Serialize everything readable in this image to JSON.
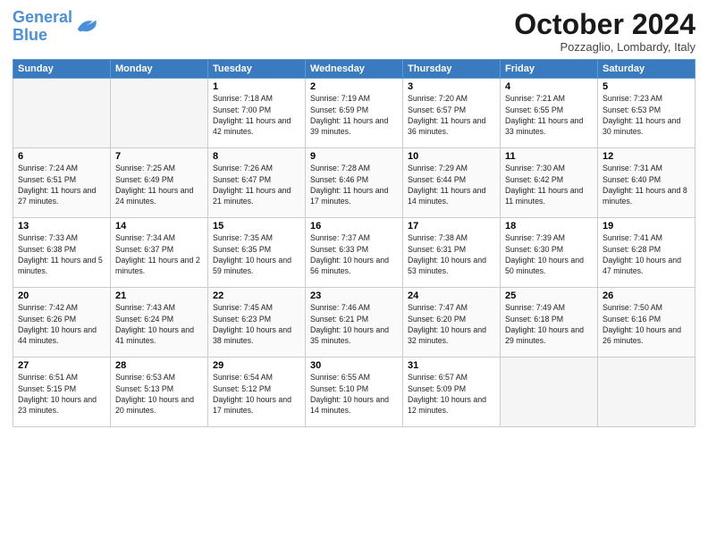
{
  "header": {
    "logo_line1": "General",
    "logo_line2": "Blue",
    "month": "October 2024",
    "location": "Pozzaglio, Lombardy, Italy"
  },
  "weekdays": [
    "Sunday",
    "Monday",
    "Tuesday",
    "Wednesday",
    "Thursday",
    "Friday",
    "Saturday"
  ],
  "weeks": [
    [
      {
        "day": "",
        "info": ""
      },
      {
        "day": "",
        "info": ""
      },
      {
        "day": "1",
        "info": "Sunrise: 7:18 AM\nSunset: 7:00 PM\nDaylight: 11 hours and 42 minutes."
      },
      {
        "day": "2",
        "info": "Sunrise: 7:19 AM\nSunset: 6:59 PM\nDaylight: 11 hours and 39 minutes."
      },
      {
        "day": "3",
        "info": "Sunrise: 7:20 AM\nSunset: 6:57 PM\nDaylight: 11 hours and 36 minutes."
      },
      {
        "day": "4",
        "info": "Sunrise: 7:21 AM\nSunset: 6:55 PM\nDaylight: 11 hours and 33 minutes."
      },
      {
        "day": "5",
        "info": "Sunrise: 7:23 AM\nSunset: 6:53 PM\nDaylight: 11 hours and 30 minutes."
      }
    ],
    [
      {
        "day": "6",
        "info": "Sunrise: 7:24 AM\nSunset: 6:51 PM\nDaylight: 11 hours and 27 minutes."
      },
      {
        "day": "7",
        "info": "Sunrise: 7:25 AM\nSunset: 6:49 PM\nDaylight: 11 hours and 24 minutes."
      },
      {
        "day": "8",
        "info": "Sunrise: 7:26 AM\nSunset: 6:47 PM\nDaylight: 11 hours and 21 minutes."
      },
      {
        "day": "9",
        "info": "Sunrise: 7:28 AM\nSunset: 6:46 PM\nDaylight: 11 hours and 17 minutes."
      },
      {
        "day": "10",
        "info": "Sunrise: 7:29 AM\nSunset: 6:44 PM\nDaylight: 11 hours and 14 minutes."
      },
      {
        "day": "11",
        "info": "Sunrise: 7:30 AM\nSunset: 6:42 PM\nDaylight: 11 hours and 11 minutes."
      },
      {
        "day": "12",
        "info": "Sunrise: 7:31 AM\nSunset: 6:40 PM\nDaylight: 11 hours and 8 minutes."
      }
    ],
    [
      {
        "day": "13",
        "info": "Sunrise: 7:33 AM\nSunset: 6:38 PM\nDaylight: 11 hours and 5 minutes."
      },
      {
        "day": "14",
        "info": "Sunrise: 7:34 AM\nSunset: 6:37 PM\nDaylight: 11 hours and 2 minutes."
      },
      {
        "day": "15",
        "info": "Sunrise: 7:35 AM\nSunset: 6:35 PM\nDaylight: 10 hours and 59 minutes."
      },
      {
        "day": "16",
        "info": "Sunrise: 7:37 AM\nSunset: 6:33 PM\nDaylight: 10 hours and 56 minutes."
      },
      {
        "day": "17",
        "info": "Sunrise: 7:38 AM\nSunset: 6:31 PM\nDaylight: 10 hours and 53 minutes."
      },
      {
        "day": "18",
        "info": "Sunrise: 7:39 AM\nSunset: 6:30 PM\nDaylight: 10 hours and 50 minutes."
      },
      {
        "day": "19",
        "info": "Sunrise: 7:41 AM\nSunset: 6:28 PM\nDaylight: 10 hours and 47 minutes."
      }
    ],
    [
      {
        "day": "20",
        "info": "Sunrise: 7:42 AM\nSunset: 6:26 PM\nDaylight: 10 hours and 44 minutes."
      },
      {
        "day": "21",
        "info": "Sunrise: 7:43 AM\nSunset: 6:24 PM\nDaylight: 10 hours and 41 minutes."
      },
      {
        "day": "22",
        "info": "Sunrise: 7:45 AM\nSunset: 6:23 PM\nDaylight: 10 hours and 38 minutes."
      },
      {
        "day": "23",
        "info": "Sunrise: 7:46 AM\nSunset: 6:21 PM\nDaylight: 10 hours and 35 minutes."
      },
      {
        "day": "24",
        "info": "Sunrise: 7:47 AM\nSunset: 6:20 PM\nDaylight: 10 hours and 32 minutes."
      },
      {
        "day": "25",
        "info": "Sunrise: 7:49 AM\nSunset: 6:18 PM\nDaylight: 10 hours and 29 minutes."
      },
      {
        "day": "26",
        "info": "Sunrise: 7:50 AM\nSunset: 6:16 PM\nDaylight: 10 hours and 26 minutes."
      }
    ],
    [
      {
        "day": "27",
        "info": "Sunrise: 6:51 AM\nSunset: 5:15 PM\nDaylight: 10 hours and 23 minutes."
      },
      {
        "day": "28",
        "info": "Sunrise: 6:53 AM\nSunset: 5:13 PM\nDaylight: 10 hours and 20 minutes."
      },
      {
        "day": "29",
        "info": "Sunrise: 6:54 AM\nSunset: 5:12 PM\nDaylight: 10 hours and 17 minutes."
      },
      {
        "day": "30",
        "info": "Sunrise: 6:55 AM\nSunset: 5:10 PM\nDaylight: 10 hours and 14 minutes."
      },
      {
        "day": "31",
        "info": "Sunrise: 6:57 AM\nSunset: 5:09 PM\nDaylight: 10 hours and 12 minutes."
      },
      {
        "day": "",
        "info": ""
      },
      {
        "day": "",
        "info": ""
      }
    ]
  ]
}
